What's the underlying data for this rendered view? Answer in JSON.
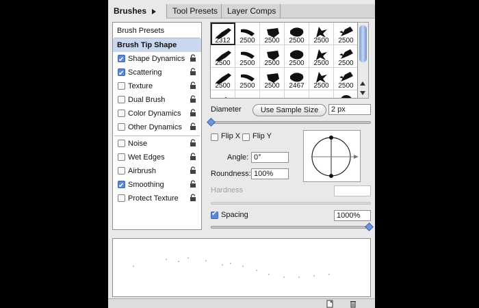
{
  "tabs": [
    {
      "label": "Brushes",
      "active": true
    },
    {
      "label": "Tool Presets",
      "active": false
    },
    {
      "label": "Layer Comps",
      "active": false
    }
  ],
  "options": {
    "brush_presets": "Brush Presets",
    "brush_tip_shape": "Brush Tip Shape",
    "items": [
      {
        "label": "Shape Dynamics",
        "checked": true
      },
      {
        "label": "Scattering",
        "checked": true
      },
      {
        "label": "Texture",
        "checked": false
      },
      {
        "label": "Dual Brush",
        "checked": false
      },
      {
        "label": "Color Dynamics",
        "checked": false
      },
      {
        "label": "Other Dynamics",
        "checked": false
      },
      {
        "label": "Noise",
        "checked": false
      },
      {
        "label": "Wet Edges",
        "checked": false
      },
      {
        "label": "Airbrush",
        "checked": false
      },
      {
        "label": "Smoothing",
        "checked": true
      },
      {
        "label": "Protect Texture",
        "checked": false
      }
    ]
  },
  "brush_grid": {
    "row1": [
      "2312",
      "2500",
      "2500",
      "2500",
      "2500",
      "2500"
    ],
    "row2": [
      "2500",
      "2500",
      "2500",
      "2500",
      "2500",
      "2500"
    ],
    "row3": [
      "2500",
      "2500",
      "2500",
      "2467",
      "2500",
      "2500"
    ],
    "selected_index": 0
  },
  "diameter": {
    "label": "Diameter",
    "button": "Use Sample Size",
    "value": "2 px",
    "slider_fraction": 0.0
  },
  "flip": {
    "x_label": "Flip X",
    "y_label": "Flip Y",
    "x_checked": false,
    "y_checked": false
  },
  "angle": {
    "label": "Angle:",
    "value": "0°"
  },
  "roundness": {
    "label": "Roundness:",
    "value": "100%"
  },
  "hardness": {
    "label": "Hardness",
    "value": "",
    "enabled": false
  },
  "spacing": {
    "label": "Spacing",
    "checked": true,
    "value": "1000%",
    "slider_fraction": 1.0
  },
  "colors": {
    "selected_row": "#c9d8ee",
    "accent": "#5b87d3",
    "panel": "#e9e9e9"
  },
  "icons": {
    "menu": "panel-menu-arrow-icon",
    "lock": "lock-icon",
    "new": "new-preset-icon",
    "trash": "trash-icon"
  }
}
